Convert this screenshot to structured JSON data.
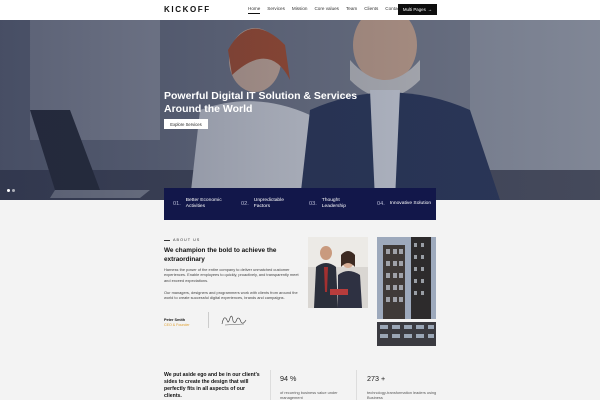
{
  "header": {
    "logo": "KICKOFF",
    "nav": [
      "Home",
      "Services",
      "Mission",
      "Core values",
      "Team",
      "Clients",
      "Contact"
    ],
    "cta_label": "Multi Pages",
    "cta_icon": "arrow-right-icon"
  },
  "hero": {
    "title": "Powerful Digital IT Solution & Services Around the World",
    "button": "Explore Services"
  },
  "features": [
    {
      "num": "01.",
      "text": "Better Economic Activities"
    },
    {
      "num": "02.",
      "text": "Unpredictable Factors"
    },
    {
      "num": "03.",
      "text": "Thought Leadership"
    },
    {
      "num": "04.",
      "text": "Innovative Solution"
    }
  ],
  "about": {
    "label": "ABOUT US",
    "title": "We champion the bold to achieve the extraordinary",
    "p1": "Harness the power of the entire company to deliver unmatched customer experiences. Enable employees to quickly, proactively, and transparently meet and exceed expectations.",
    "p2": "Our managers, designers and programmers work with clients from around the world to create successful digital experiences, brands and campaigns.",
    "sig_name": "Peter Smith",
    "sig_role": "CEO & Founder"
  },
  "bottom": {
    "title": "We put aside ego and be in our client’s sides to create the design that will perfectly fits in all aspects of our clients.",
    "stats": [
      {
        "value": "94 %",
        "label": "of recurring business value under management"
      },
      {
        "value": "273 +",
        "label": "technology-transformation leaders using Business"
      }
    ]
  },
  "colors": {
    "accent_navy": "#12174a",
    "role_orange": "#e0a030"
  }
}
